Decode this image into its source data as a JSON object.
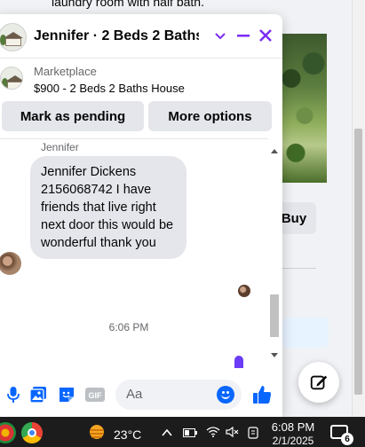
{
  "background": {
    "listing_text": "laundry room with half bath.",
    "buy_label": "Buy"
  },
  "chat": {
    "title": "Jennifer · 2 Beds 2 Baths H...",
    "marketplace_label": "Marketplace",
    "listing": "$900 - 2 Beds 2 Baths House",
    "buttons": {
      "pending": "Mark as pending",
      "more": "More options"
    },
    "sender_name": "Jennifer",
    "message": "Jennifer Dickens 2156068742 I have friends that live right next door this would be wonderful thank you",
    "timestamp": "6:06 PM",
    "composer": {
      "placeholder": "Aa"
    }
  },
  "taskbar": {
    "temperature": "23°C",
    "time": "6:08 PM",
    "date": "2/1/2025",
    "notification_count": "6"
  },
  "colors": {
    "accent": "#0866ff",
    "typing": "#6b3cf5",
    "close": "#7b2cf5",
    "bubble": "#e4e6eb",
    "taskbar": "#1c1c1c"
  }
}
